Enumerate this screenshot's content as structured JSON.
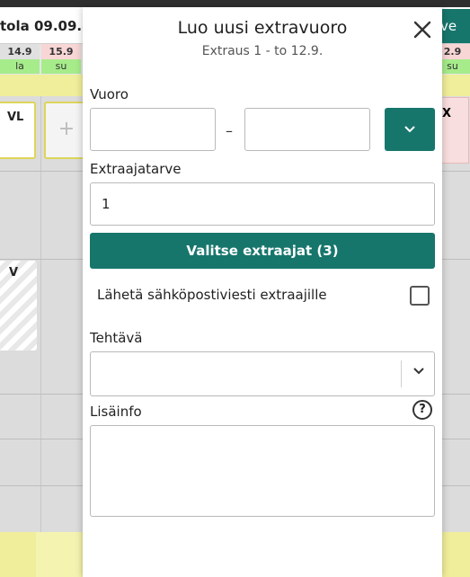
{
  "background": {
    "header_title": "tola  09.09.–",
    "save_label": "ve",
    "left_dates": [
      {
        "date": "14.9",
        "day": "la"
      },
      {
        "date": "15.9",
        "day": "su"
      }
    ],
    "right_date": {
      "date": "2.9",
      "day": "su"
    },
    "shift_vl": "VL",
    "shift_x": "X",
    "shift_v": "V",
    "add_symbol": "+"
  },
  "modal": {
    "title": "Luo uusi extravuoro",
    "subtitle": "Extraus 1 - to 12.9.",
    "shift_label": "Vuoro",
    "shift_start": "",
    "shift_end": "",
    "shift_separator": "–",
    "need_label": "Extraajatarve",
    "need_value": "1",
    "select_extras_button": "Valitse extraajat (3)",
    "email_label": "Lähetä sähköpostiviesti extraajille",
    "email_checked": false,
    "task_label": "Tehtävä",
    "task_value": "",
    "info_label": "Lisäinfo",
    "info_value": "",
    "help_symbol": "?"
  },
  "colors": {
    "primary": "#17766c",
    "weekend_green": "#a6ec8a",
    "highlight_yellow": "#f0ee9a"
  },
  "icons": {
    "close": "close-icon",
    "shift_dropdown": "chevron-down-icon",
    "task_select": "chevron-down-icon",
    "help": "help-icon"
  }
}
